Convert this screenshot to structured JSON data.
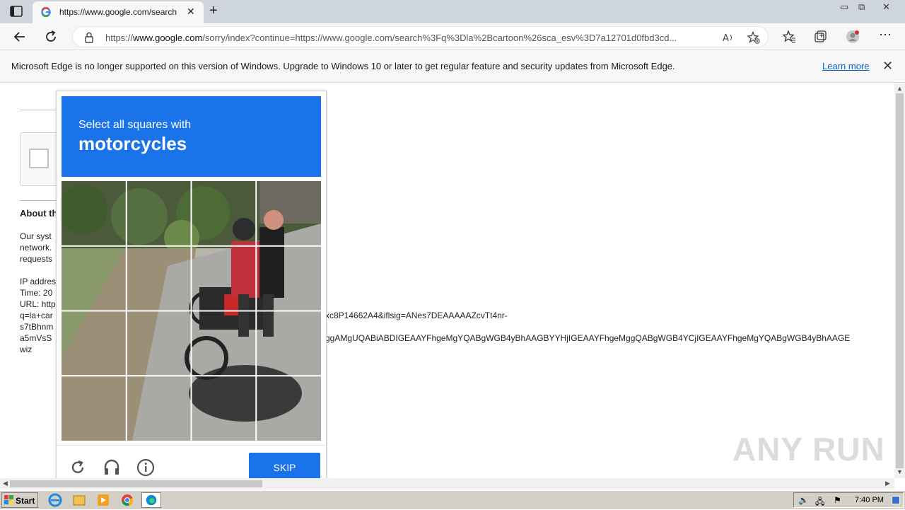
{
  "browser": {
    "tab_title": "https://www.google.com/search",
    "url_prefix": "https://",
    "url_domain": "www.google.com",
    "url_rest": "/sorry/index?continue=https://www.google.com/search%3Fq%3Dla%2Bcartoon%26sca_esv%3D7a12701d0fbd3cd..."
  },
  "infobar": {
    "message": "Microsoft Edge is no longer supported on this version of Windows. Upgrade to Windows 10 or later to get regular feature and security updates from Microsoft Edge.",
    "learn_more": "Learn more"
  },
  "page": {
    "about_heading": "About th",
    "line1": "Our syst",
    "line2": "network.",
    "line3": "requests",
    "ip_label": "IP addres",
    "time_label": "Time: 20",
    "url_label": "URL: http",
    "q_line": "q=la+car",
    "s7_line": "s7tBhnm",
    "a5_line": "a5mVsS",
    "wiz_line": "wiz",
    "sig_fragment": "xc8P14662A4&iflsig=ANes7DEAAAAAZcvTt4nr-",
    "long_fragment": "ggAMgUQABiABDIGEAAYFhgeMgYQABgWGB4yBhAAGBYYHjIGEAAYFhgeMggQABgWGB4YCjIGEAAYFhgeMgYQABgWGB4yBhAAGE"
  },
  "captcha": {
    "instruction": "Select all squares with",
    "target": "motorcycles",
    "skip_label": "SKIP",
    "grid_size": 4
  },
  "taskbar": {
    "start_label": "Start",
    "time": "7:40 PM"
  },
  "watermark": "ANY RUN",
  "colors": {
    "accent": "#1a73e8",
    "link": "#0563c1"
  }
}
